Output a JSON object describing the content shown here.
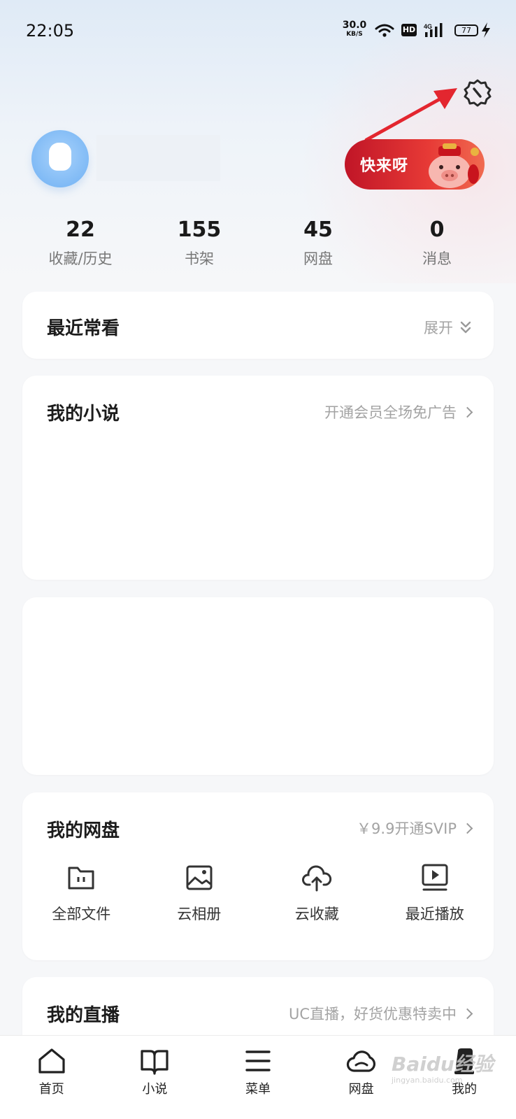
{
  "status_bar": {
    "time": "22:05",
    "net_speed_value": "30.0",
    "net_speed_unit": "KB/S",
    "hd_label": "HD",
    "network": "4G",
    "battery": "77"
  },
  "stats": [
    {
      "value": "22",
      "label": "收藏/历史"
    },
    {
      "value": "155",
      "label": "书架"
    },
    {
      "value": "45",
      "label": "网盘"
    },
    {
      "value": "0",
      "label": "消息"
    }
  ],
  "promo": {
    "label": "快来呀"
  },
  "recent": {
    "title": "最近常看",
    "action": "展开"
  },
  "novel": {
    "title": "我的小说",
    "link": "开通会员全场免广告"
  },
  "disk": {
    "title": "我的网盘",
    "link": "￥9.9开通SVIP",
    "items": [
      {
        "label": "全部文件",
        "icon": "folder-icon"
      },
      {
        "label": "云相册",
        "icon": "photo-icon"
      },
      {
        "label": "云收藏",
        "icon": "cloud-upload-icon"
      },
      {
        "label": "最近播放",
        "icon": "play-icon"
      }
    ]
  },
  "live": {
    "title": "我的直播",
    "link": "UC直播，好货优惠特卖中"
  },
  "nav": [
    {
      "label": "首页",
      "icon": "home-icon"
    },
    {
      "label": "小说",
      "icon": "book-icon"
    },
    {
      "label": "菜单",
      "icon": "menu-icon"
    },
    {
      "label": "网盘",
      "icon": "cloud-icon"
    },
    {
      "label": "我的",
      "icon": "profile-icon"
    }
  ],
  "watermark": {
    "text": "Baidu经验",
    "sub": "jingyan.baidu.com"
  },
  "colors": {
    "accent_red": "#e3262f",
    "background": "#f6f7f9"
  }
}
